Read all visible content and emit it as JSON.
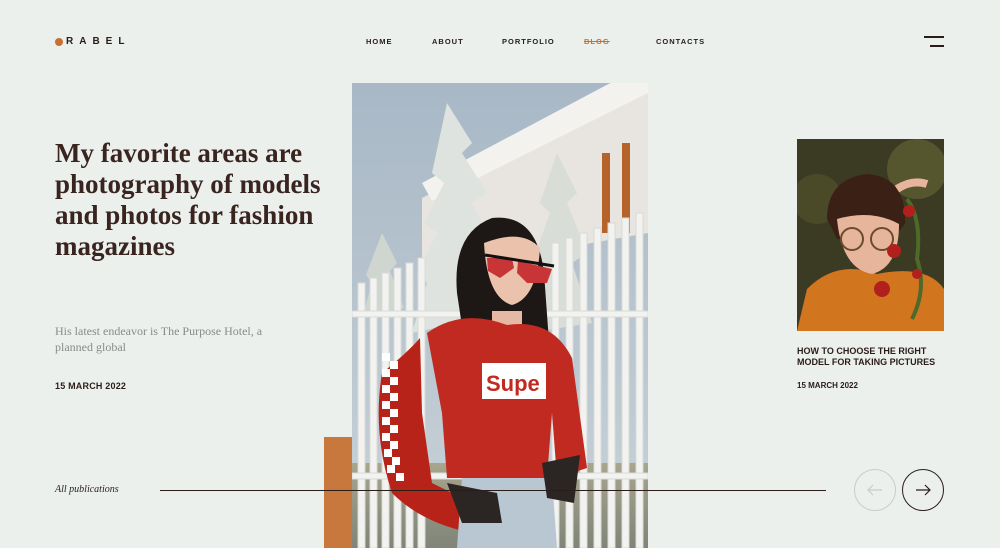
{
  "brand": {
    "logo_text": "RABEL",
    "accent": "#c8702f"
  },
  "nav": {
    "items": [
      {
        "label": "HOME"
      },
      {
        "label": "ABOUT"
      },
      {
        "label": "PORTFOLIO"
      },
      {
        "label": "BLOG",
        "active": true
      },
      {
        "label": "CONTACTS"
      }
    ]
  },
  "hero": {
    "title": "My favorite areas are photography of models and photos for fashion magazines",
    "subtitle": "His latest endeavor is The Purpose Hotel, a planned global",
    "date": "15 MARCH 2022"
  },
  "main_photo": {
    "shirt_text": "Supe"
  },
  "side_post": {
    "title": "HOW TO CHOOSE THE RIGHT MODEL FOR TAKING PICTURES",
    "date": "15 MARCH 2022"
  },
  "footer": {
    "all_publications": "All publications"
  },
  "icons": {
    "menu": "hamburger-menu-icon",
    "prev": "arrow-left-icon",
    "next": "arrow-right-icon"
  }
}
